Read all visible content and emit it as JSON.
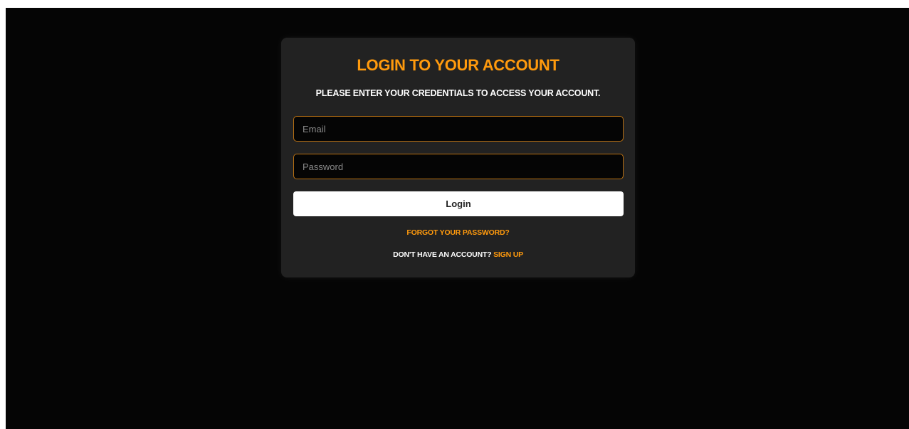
{
  "colors": {
    "background": "#050505",
    "card": "#222222",
    "accent": "#ff9a0d",
    "input_border": "#b87012",
    "button_bg": "#ffffff"
  },
  "login": {
    "title": "LOGIN TO YOUR ACCOUNT",
    "subtitle": "PLEASE ENTER YOUR CREDENTIALS TO ACCESS YOUR ACCOUNT.",
    "email_placeholder": "Email",
    "email_value": "",
    "password_placeholder": "Password",
    "password_value": "",
    "login_label": "Login",
    "forgot_label": "FORGOT YOUR PASSWORD?",
    "no_account_text": "DON'T HAVE AN ACCOUNT?",
    "signup_label": "SIGN UP"
  }
}
